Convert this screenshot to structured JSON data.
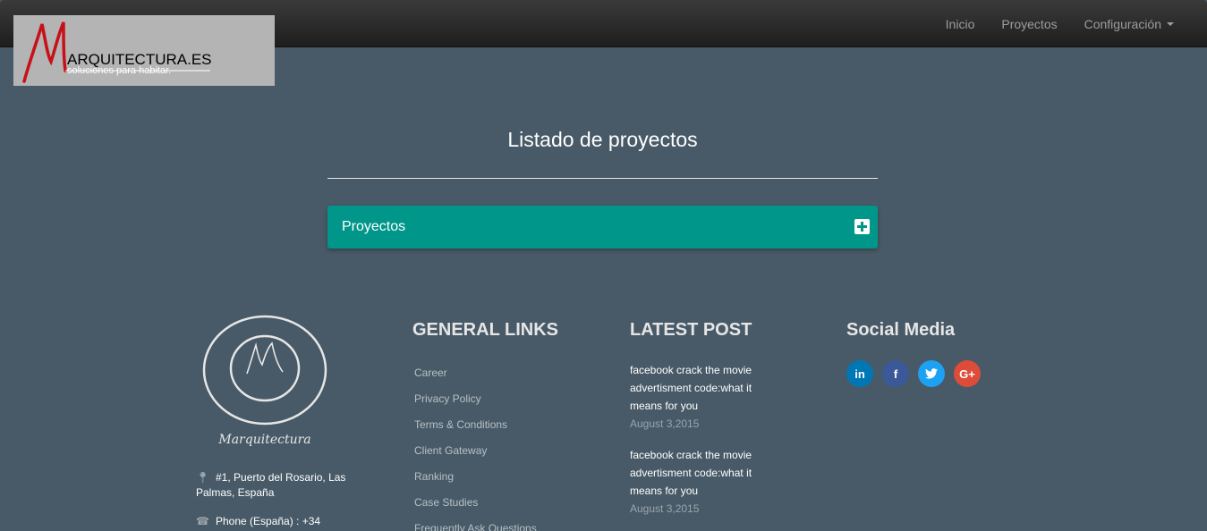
{
  "navbar": {
    "items": [
      {
        "label": "Inicio"
      },
      {
        "label": "Proyectos"
      },
      {
        "label": "Configuración"
      }
    ]
  },
  "logo": {
    "title": "ARQUITECTURA.ES",
    "subtitle": "soluciones para habitar."
  },
  "main": {
    "title": "Listado de proyectos",
    "panel_label": "Proyectos"
  },
  "footer": {
    "emblem_caption": "Marquitectura",
    "address": "#1, Puerto del Rosario, Las Palmas, España",
    "phone": "Phone (España) : +34",
    "general_links": {
      "heading": "GENERAL LINKS",
      "items": [
        "Career",
        "Privacy Policy",
        "Terms & Conditions",
        "Client Gateway",
        "Ranking",
        "Case Studies",
        "Frequently Ask Questions"
      ]
    },
    "latest_post": {
      "heading": "LATEST POST",
      "posts": [
        {
          "title": "facebook crack the movie advertisment code:what it means for you",
          "date": "August 3,2015"
        },
        {
          "title": "facebook crack the movie advertisment code:what it means for you",
          "date": "August 3,2015"
        }
      ]
    },
    "social": {
      "heading": "Social Media",
      "icons": [
        {
          "name": "linkedin-icon",
          "glyph": "in",
          "color": "#0077b5"
        },
        {
          "name": "facebook-icon",
          "glyph": "f",
          "color": "#3b5998"
        },
        {
          "name": "twitter-icon",
          "glyph": "t",
          "color": "#1da1f2"
        },
        {
          "name": "google-plus-icon",
          "glyph": "G+",
          "color": "#dd4b39"
        }
      ]
    }
  },
  "colors": {
    "background": "#485a67",
    "navbar": "#222222",
    "panel": "#00968a"
  }
}
